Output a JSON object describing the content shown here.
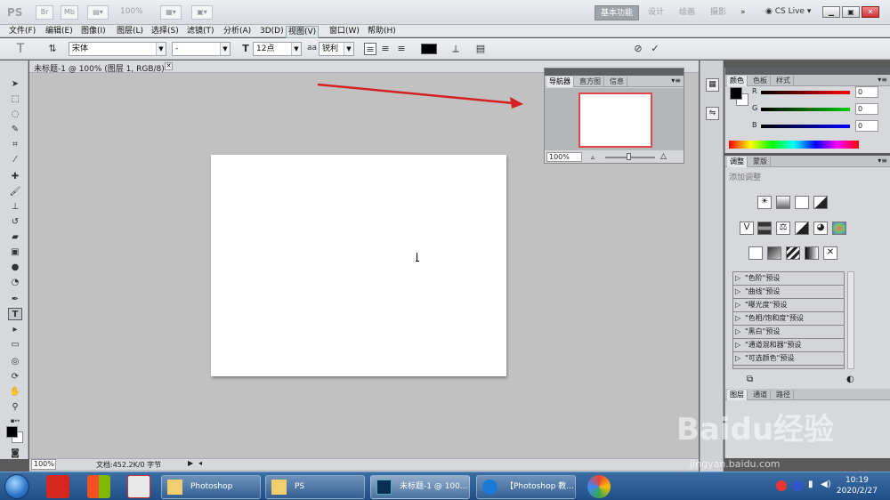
{
  "titlebar": {
    "logo": "PS",
    "br": "Br",
    "mb": "Mb",
    "zoom": "100%",
    "workspaces": [
      "基本功能",
      "设计",
      "绘画",
      "摄影"
    ],
    "more": "»",
    "cslive": "CS Live"
  },
  "menu": [
    "文件(F)",
    "编辑(E)",
    "图像(I)",
    "图层(L)",
    "选择(S)",
    "滤镜(T)",
    "分析(A)",
    "3D(D)",
    "视图(V)",
    "窗口(W)",
    "帮助(H)"
  ],
  "options": {
    "font_family": "宋体",
    "font_style": "-",
    "font_size": "12点",
    "aa_label": "aa",
    "aa_mode": "锐利"
  },
  "document": {
    "tab_title": "未标题-1 @ 100% (图层 1, RGB/8) *",
    "status_zoom": "100%",
    "status_doc": "文档:452.2K/0 字节"
  },
  "navigator": {
    "tabs": [
      "导航器",
      "直方图",
      "信息"
    ],
    "zoom": "100%"
  },
  "color_panel": {
    "tabs": [
      "颜色",
      "色板",
      "样式"
    ],
    "sliders": [
      {
        "label": "R",
        "value": "0",
        "color": "#cc0000"
      },
      {
        "label": "G",
        "value": "0",
        "color": "#00aa00"
      },
      {
        "label": "B",
        "value": "0",
        "color": "#0000cc"
      }
    ]
  },
  "adjust_panel": {
    "tabs": [
      "调整",
      "蒙版"
    ],
    "title": "添加调整",
    "presets": [
      "\"色阶\"预设",
      "\"曲线\"预设",
      "\"曝光度\"预设",
      "\"色相/饱和度\"预设",
      "\"黑白\"预设",
      "\"通道混和器\"预设",
      "\"可选颜色\"预设"
    ]
  },
  "layers_panel": {
    "tabs": [
      "图层",
      "通道",
      "路径"
    ]
  },
  "taskbar": {
    "tasks": [
      "Photoshop",
      "PS",
      "未标题-1 @ 100...",
      "【Photoshop 教..."
    ],
    "time": "10:19",
    "date": "2020/2/27"
  },
  "watermark": {
    "brand": "Baidu经验",
    "url": "jingyan.baidu.com"
  }
}
